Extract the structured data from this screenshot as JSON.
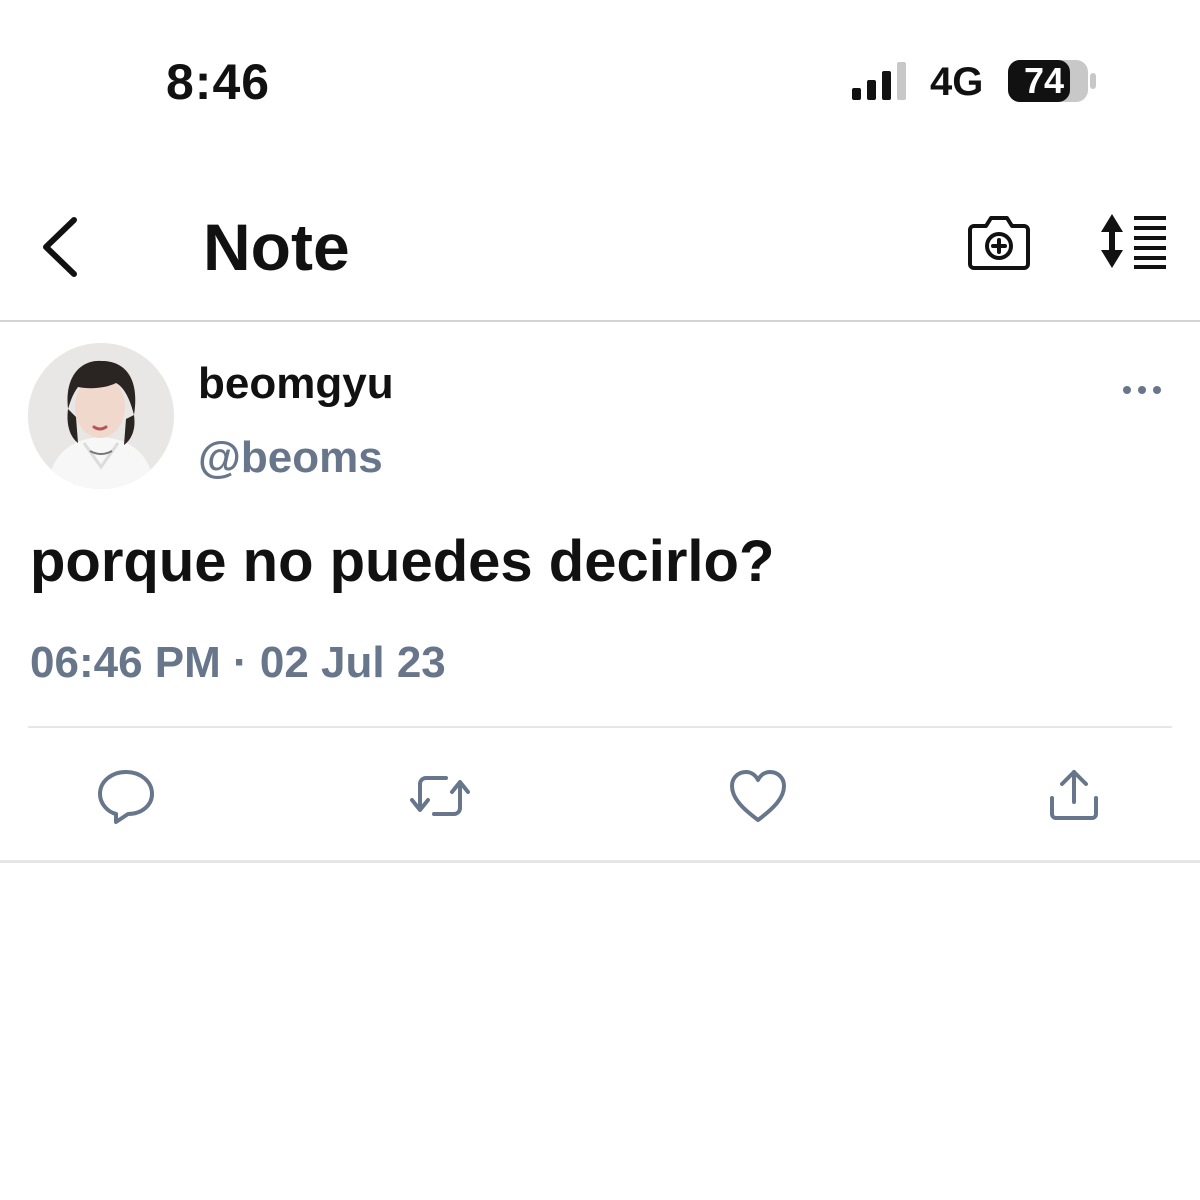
{
  "status_bar": {
    "time": "8:46",
    "network": "4G",
    "battery": "74",
    "icons": [
      "signal-icon",
      "battery-icon"
    ]
  },
  "header": {
    "title": "Note",
    "icons": [
      "back-chevron-icon",
      "camera-plus-icon",
      "sort-arrows-icon"
    ]
  },
  "tweet": {
    "display_name": "beomgyu",
    "handle": "@beoms",
    "text": "porque no puedes decirlo?",
    "timestamp": "06:46 PM · 02 Jul 23",
    "icons": [
      "more-options-icon"
    ]
  },
  "actions": {
    "icons": [
      "reply-icon",
      "retweet-icon",
      "like-icon",
      "share-icon"
    ]
  },
  "colors": {
    "primary_text": "#111111",
    "secondary_text": "#67768a",
    "divider": "#e6e6e6",
    "icon": "#67768a"
  }
}
